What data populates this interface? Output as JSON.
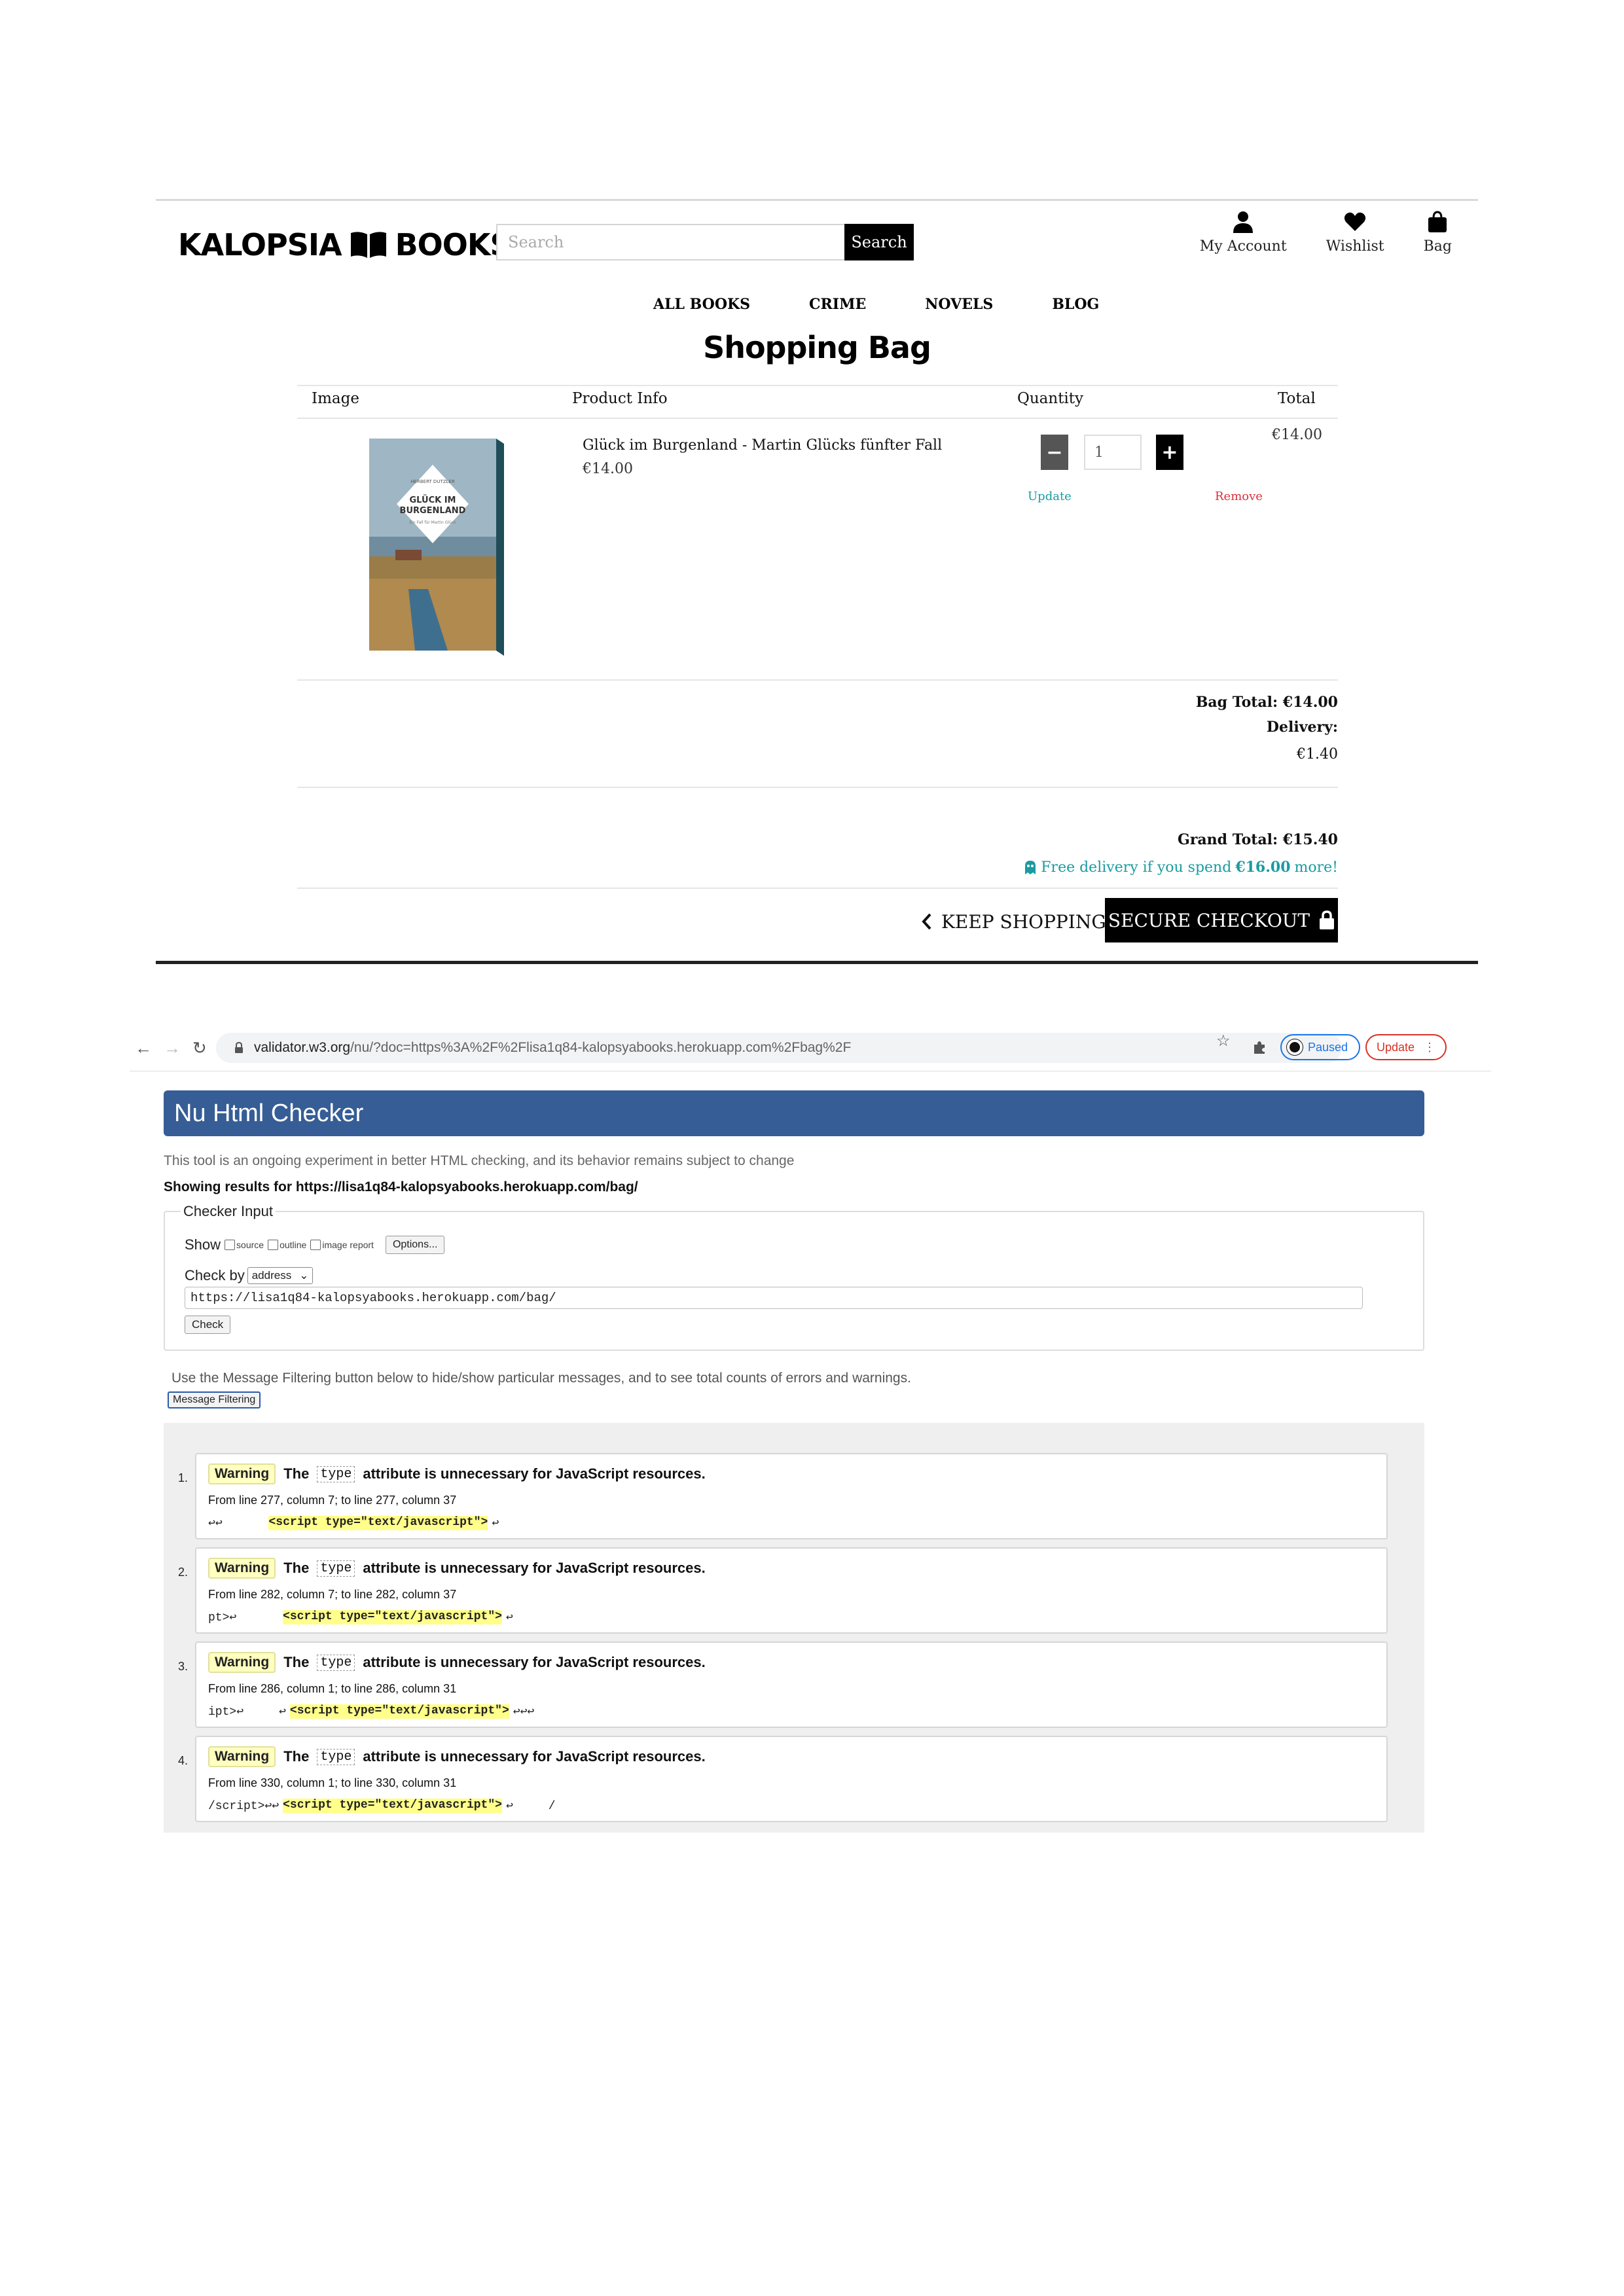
{
  "shop": {
    "logo": {
      "left": "KALOPSIA",
      "right": "BOOKS",
      "icon": "open-book-icon"
    },
    "search": {
      "placeholder": "Search",
      "button_label": "Search"
    },
    "nav_icons": [
      {
        "label": "My Account",
        "icon": "user-icon"
      },
      {
        "label": "Wishlist",
        "icon": "heart-icon"
      },
      {
        "label": "Bag",
        "icon": "shopping-bag-icon"
      }
    ],
    "menu": [
      "ALL BOOKS",
      "CRIME",
      "NOVELS",
      "BLOG"
    ],
    "page_title": "Shopping Bag",
    "table_headers": {
      "image": "Image",
      "product": "Product Info",
      "quantity": "Quantity",
      "total": "Total"
    },
    "item": {
      "cover_title": "GLÜCK IM BURGENLAND",
      "title": "Glück im Burgenland - Martin Glücks fünfter Fall",
      "price": "€14.00",
      "quantity": "1",
      "update_label": "Update",
      "remove_label": "Remove",
      "total": "€14.00"
    },
    "summary": {
      "bag_total_label": "Bag Total: €14.00",
      "delivery_label": "Delivery:",
      "delivery_value": "€1.40",
      "grand_total_label": "Grand Total: €15.40",
      "free_delivery_prefix": "Free delivery if you spend",
      "free_delivery_amount": "€16.00",
      "free_delivery_suffix": "more!"
    },
    "buttons": {
      "keep_shopping": "KEEP SHOPPING",
      "secure_checkout": "SECURE CHECKOUT"
    },
    "colors": {
      "accent": "#1a9ba0",
      "remove": "#d9303f"
    }
  },
  "validator": {
    "browser": {
      "url_host": "validator.w3.org",
      "url_rest": "/nu/?doc=https%3A%2F%2Flisa1q84-kalopsyabooks.herokuapp.com%2Fbag%2F",
      "paused_label": "Paused",
      "update_label": "Update"
    },
    "header": "Nu Html Checker",
    "tagline": "This tool is an ongoing experiment in better HTML checking, and its behavior remains subject to change",
    "results_for": "Showing results for https://lisa1q84-kalopsyabooks.herokuapp.com/bag/",
    "checker": {
      "legend": "Checker Input",
      "show_label": "Show",
      "options": [
        "source",
        "outline",
        "image report"
      ],
      "options_button": "Options...",
      "check_by_label": "Check by",
      "check_by_value": "address",
      "url_value": "https://lisa1q84-kalopsyabooks.herokuapp.com/bag/",
      "check_button": "Check"
    },
    "filter_hint": "Use the Message Filtering button below to hide/show particular messages, and to see total counts of errors and warnings.",
    "filter_button": "Message Filtering",
    "messages": [
      {
        "num": "1.",
        "badge": "Warning",
        "pre": "The",
        "code": "type",
        "post": "attribute is unnecessary for JavaScript resources.",
        "location": "From line 277, column 7; to line 277, column 37",
        "extract_before": "↩↩      ",
        "extract_hl": "<script type=\"text/javascript\">",
        "extract_after": "↩"
      },
      {
        "num": "2.",
        "badge": "Warning",
        "pre": "The",
        "code": "type",
        "post": "attribute is unnecessary for JavaScript resources.",
        "location": "From line 282, column 7; to line 282, column 37",
        "extract_before": "pt>↩      ",
        "extract_hl": "<script type=\"text/javascript\">",
        "extract_after": "↩"
      },
      {
        "num": "3.",
        "badge": "Warning",
        "pre": "The",
        "code": "type",
        "post": "attribute is unnecessary for JavaScript resources.",
        "location": "From line 286, column 1; to line 286, column 31",
        "extract_before": "ipt>↩     ↩",
        "extract_hl": "<script type=\"text/javascript\">",
        "extract_after": "↩↩↩"
      },
      {
        "num": "4.",
        "badge": "Warning",
        "pre": "The",
        "code": "type",
        "post": "attribute is unnecessary for JavaScript resources.",
        "location": "From line 330, column 1; to line 330, column 31",
        "extract_before": "/script>↩↩",
        "extract_hl": "<script type=\"text/javascript\">",
        "extract_after": "↩     /"
      }
    ]
  }
}
